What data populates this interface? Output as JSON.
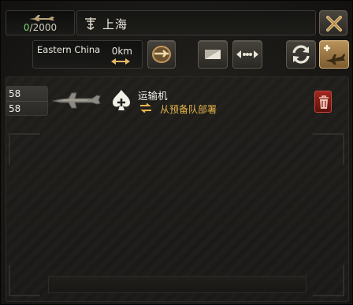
{
  "header": {
    "air_wing_count": {
      "current": "0",
      "separator": "/",
      "max": "2000"
    },
    "region_name": "上海"
  },
  "toolbar": {
    "state_name": "Eastern China",
    "distance": "0km"
  },
  "air_wings": [
    {
      "strength_current": "58",
      "strength_max": "58",
      "unit_name": "运输机",
      "deploy_status": "从预备队部署"
    }
  ],
  "icons": {
    "count": "plane-icon",
    "region": "airbase-emblem-icon",
    "close": "close-icon",
    "range": "double-arrow-icon",
    "airfield": "airfield-icon",
    "toggle": "toggle-icon",
    "merge": "merge-icon",
    "cycle": "cycle-icon",
    "add": "add-plane-icon",
    "unit_type": "transport-type-icon",
    "deploy": "swap-icon",
    "delete": "trash-icon"
  },
  "colors": {
    "count_current": "#7bd46a",
    "deploy_status": "#e8b54a",
    "delete_button": "#a2271f",
    "add_button": "#b8925a"
  }
}
